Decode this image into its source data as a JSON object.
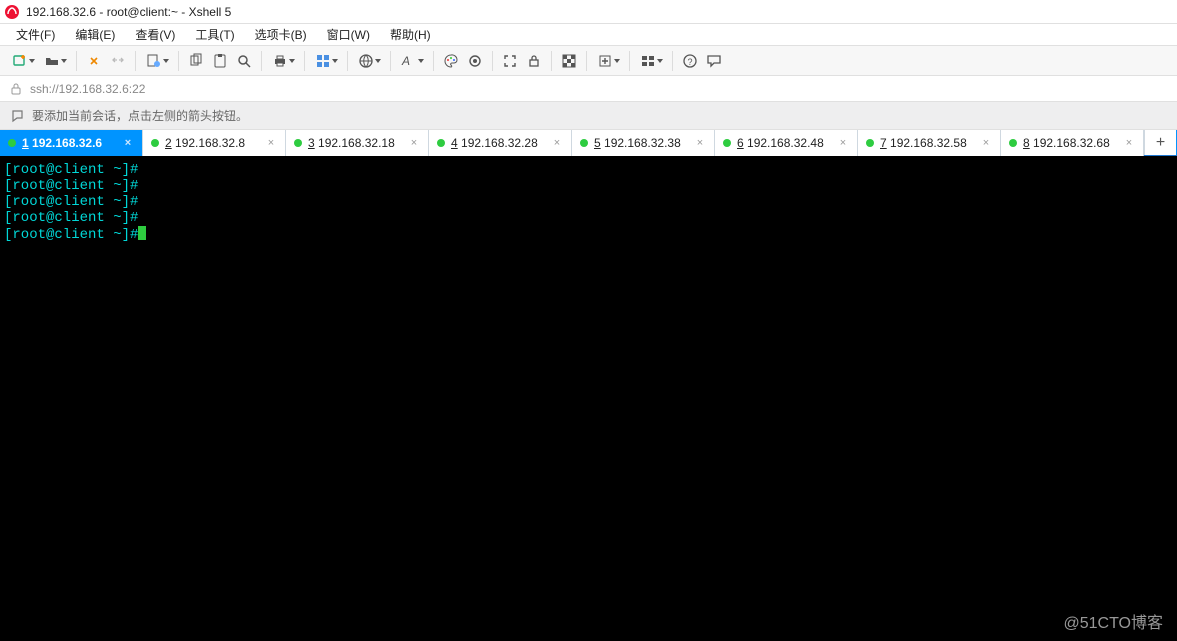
{
  "window": {
    "title": "192.168.32.6 - root@client:~ - Xshell 5"
  },
  "menu": {
    "file": "文件(F)",
    "edit": "编辑(E)",
    "view": "查看(V)",
    "tools": "工具(T)",
    "tabs": "选项卡(B)",
    "window": "窗口(W)",
    "help": "帮助(H)"
  },
  "addressbar": {
    "url": "ssh://192.168.32.6:22"
  },
  "hintbar": {
    "text": "要添加当前会话，点击左侧的箭头按钮。"
  },
  "tabs": [
    {
      "num": "1",
      "label": "192.168.32.6",
      "active": true
    },
    {
      "num": "2",
      "label": "192.168.32.8",
      "active": false
    },
    {
      "num": "3",
      "label": "192.168.32.18",
      "active": false
    },
    {
      "num": "4",
      "label": "192.168.32.28",
      "active": false
    },
    {
      "num": "5",
      "label": "192.168.32.38",
      "active": false
    },
    {
      "num": "6",
      "label": "192.168.32.48",
      "active": false
    },
    {
      "num": "7",
      "label": "192.168.32.58",
      "active": false
    },
    {
      "num": "8",
      "label": "192.168.32.68",
      "active": false
    }
  ],
  "add_tab_label": "+",
  "terminal": {
    "prompt": "[root@client ~]#",
    "line_count": 5
  },
  "watermark": "@51CTO博客"
}
